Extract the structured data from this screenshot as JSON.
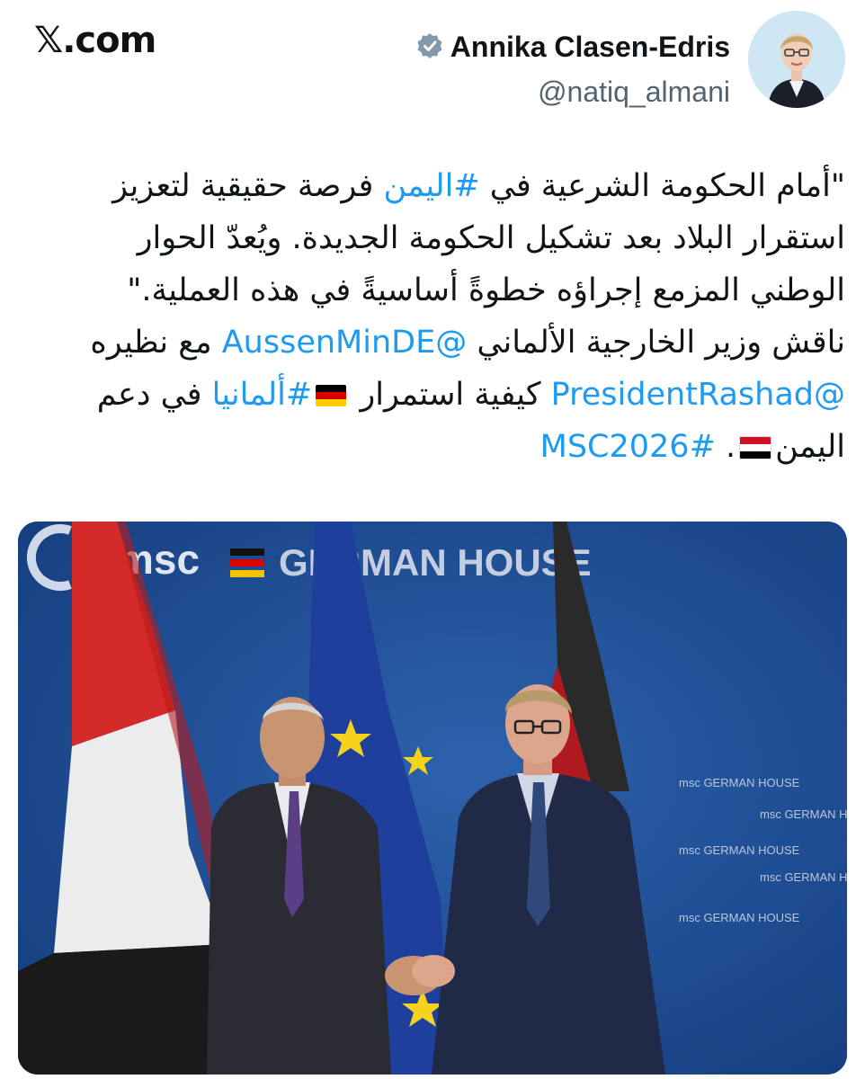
{
  "site_logo": "𝕏.com",
  "author": {
    "name": "Annika Clasen-Edris",
    "handle": "@natiq_almani",
    "verified": true
  },
  "tweet": {
    "line1_pre": "\"أمام الحكومة الشرعية في ",
    "hashtag_yemen": "#اليمن",
    "line1_post": " فرصة حقيقية لتعزيز",
    "line2": "استقرار البلاد بعد تشكيل الحكومة الجديدة. ويُعدّ الحوار",
    "line3": "الوطني المزمع إجراؤه خطوةً أساسيةً في هذه العملية.\"",
    "line4_pre": "ناقش وزير الخارجية الألماني ",
    "mention_aussenmin": "@AussenMinDE",
    "line4_post": " مع نظيره",
    "mention_president": "@PresidentRashad",
    "line5_mid": " كيفية استمرار ",
    "hashtag_germany": "#ألمانيا",
    "line5_post": " في دعم",
    "line6_pre": "اليمن",
    "line6_mid": ". ",
    "hashtag_msc": "#MSC2026"
  },
  "photo": {
    "backdrop_text_msc": "msc",
    "backdrop_text_house": "GERMAN HOUSE",
    "small_logo_text": "msc GERMAN HOUSE"
  },
  "colors": {
    "link": "#1d9bf0",
    "verified_badge": "#829aab",
    "backdrop_blue": "#1f4f96"
  }
}
